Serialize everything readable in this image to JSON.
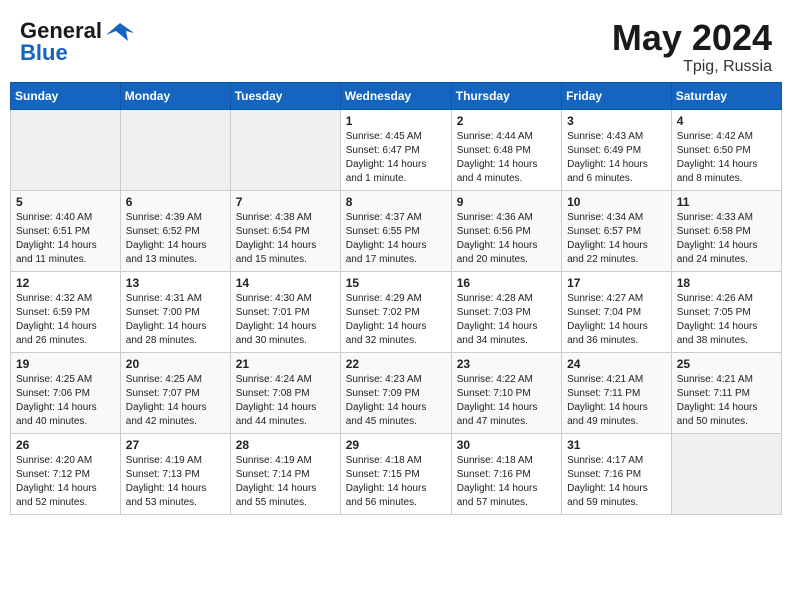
{
  "header": {
    "logo_general": "General",
    "logo_blue": "Blue",
    "month": "May 2024",
    "location": "Tpig, Russia"
  },
  "weekdays": [
    "Sunday",
    "Monday",
    "Tuesday",
    "Wednesday",
    "Thursday",
    "Friday",
    "Saturday"
  ],
  "weeks": [
    [
      {
        "day": "",
        "sunrise": "",
        "sunset": "",
        "daylight": ""
      },
      {
        "day": "",
        "sunrise": "",
        "sunset": "",
        "daylight": ""
      },
      {
        "day": "",
        "sunrise": "",
        "sunset": "",
        "daylight": ""
      },
      {
        "day": "1",
        "sunrise": "Sunrise: 4:45 AM",
        "sunset": "Sunset: 6:47 PM",
        "daylight": "Daylight: 14 hours and 1 minute."
      },
      {
        "day": "2",
        "sunrise": "Sunrise: 4:44 AM",
        "sunset": "Sunset: 6:48 PM",
        "daylight": "Daylight: 14 hours and 4 minutes."
      },
      {
        "day": "3",
        "sunrise": "Sunrise: 4:43 AM",
        "sunset": "Sunset: 6:49 PM",
        "daylight": "Daylight: 14 hours and 6 minutes."
      },
      {
        "day": "4",
        "sunrise": "Sunrise: 4:42 AM",
        "sunset": "Sunset: 6:50 PM",
        "daylight": "Daylight: 14 hours and 8 minutes."
      }
    ],
    [
      {
        "day": "5",
        "sunrise": "Sunrise: 4:40 AM",
        "sunset": "Sunset: 6:51 PM",
        "daylight": "Daylight: 14 hours and 11 minutes."
      },
      {
        "day": "6",
        "sunrise": "Sunrise: 4:39 AM",
        "sunset": "Sunset: 6:52 PM",
        "daylight": "Daylight: 14 hours and 13 minutes."
      },
      {
        "day": "7",
        "sunrise": "Sunrise: 4:38 AM",
        "sunset": "Sunset: 6:54 PM",
        "daylight": "Daylight: 14 hours and 15 minutes."
      },
      {
        "day": "8",
        "sunrise": "Sunrise: 4:37 AM",
        "sunset": "Sunset: 6:55 PM",
        "daylight": "Daylight: 14 hours and 17 minutes."
      },
      {
        "day": "9",
        "sunrise": "Sunrise: 4:36 AM",
        "sunset": "Sunset: 6:56 PM",
        "daylight": "Daylight: 14 hours and 20 minutes."
      },
      {
        "day": "10",
        "sunrise": "Sunrise: 4:34 AM",
        "sunset": "Sunset: 6:57 PM",
        "daylight": "Daylight: 14 hours and 22 minutes."
      },
      {
        "day": "11",
        "sunrise": "Sunrise: 4:33 AM",
        "sunset": "Sunset: 6:58 PM",
        "daylight": "Daylight: 14 hours and 24 minutes."
      }
    ],
    [
      {
        "day": "12",
        "sunrise": "Sunrise: 4:32 AM",
        "sunset": "Sunset: 6:59 PM",
        "daylight": "Daylight: 14 hours and 26 minutes."
      },
      {
        "day": "13",
        "sunrise": "Sunrise: 4:31 AM",
        "sunset": "Sunset: 7:00 PM",
        "daylight": "Daylight: 14 hours and 28 minutes."
      },
      {
        "day": "14",
        "sunrise": "Sunrise: 4:30 AM",
        "sunset": "Sunset: 7:01 PM",
        "daylight": "Daylight: 14 hours and 30 minutes."
      },
      {
        "day": "15",
        "sunrise": "Sunrise: 4:29 AM",
        "sunset": "Sunset: 7:02 PM",
        "daylight": "Daylight: 14 hours and 32 minutes."
      },
      {
        "day": "16",
        "sunrise": "Sunrise: 4:28 AM",
        "sunset": "Sunset: 7:03 PM",
        "daylight": "Daylight: 14 hours and 34 minutes."
      },
      {
        "day": "17",
        "sunrise": "Sunrise: 4:27 AM",
        "sunset": "Sunset: 7:04 PM",
        "daylight": "Daylight: 14 hours and 36 minutes."
      },
      {
        "day": "18",
        "sunrise": "Sunrise: 4:26 AM",
        "sunset": "Sunset: 7:05 PM",
        "daylight": "Daylight: 14 hours and 38 minutes."
      }
    ],
    [
      {
        "day": "19",
        "sunrise": "Sunrise: 4:25 AM",
        "sunset": "Sunset: 7:06 PM",
        "daylight": "Daylight: 14 hours and 40 minutes."
      },
      {
        "day": "20",
        "sunrise": "Sunrise: 4:25 AM",
        "sunset": "Sunset: 7:07 PM",
        "daylight": "Daylight: 14 hours and 42 minutes."
      },
      {
        "day": "21",
        "sunrise": "Sunrise: 4:24 AM",
        "sunset": "Sunset: 7:08 PM",
        "daylight": "Daylight: 14 hours and 44 minutes."
      },
      {
        "day": "22",
        "sunrise": "Sunrise: 4:23 AM",
        "sunset": "Sunset: 7:09 PM",
        "daylight": "Daylight: 14 hours and 45 minutes."
      },
      {
        "day": "23",
        "sunrise": "Sunrise: 4:22 AM",
        "sunset": "Sunset: 7:10 PM",
        "daylight": "Daylight: 14 hours and 47 minutes."
      },
      {
        "day": "24",
        "sunrise": "Sunrise: 4:21 AM",
        "sunset": "Sunset: 7:11 PM",
        "daylight": "Daylight: 14 hours and 49 minutes."
      },
      {
        "day": "25",
        "sunrise": "Sunrise: 4:21 AM",
        "sunset": "Sunset: 7:11 PM",
        "daylight": "Daylight: 14 hours and 50 minutes."
      }
    ],
    [
      {
        "day": "26",
        "sunrise": "Sunrise: 4:20 AM",
        "sunset": "Sunset: 7:12 PM",
        "daylight": "Daylight: 14 hours and 52 minutes."
      },
      {
        "day": "27",
        "sunrise": "Sunrise: 4:19 AM",
        "sunset": "Sunset: 7:13 PM",
        "daylight": "Daylight: 14 hours and 53 minutes."
      },
      {
        "day": "28",
        "sunrise": "Sunrise: 4:19 AM",
        "sunset": "Sunset: 7:14 PM",
        "daylight": "Daylight: 14 hours and 55 minutes."
      },
      {
        "day": "29",
        "sunrise": "Sunrise: 4:18 AM",
        "sunset": "Sunset: 7:15 PM",
        "daylight": "Daylight: 14 hours and 56 minutes."
      },
      {
        "day": "30",
        "sunrise": "Sunrise: 4:18 AM",
        "sunset": "Sunset: 7:16 PM",
        "daylight": "Daylight: 14 hours and 57 minutes."
      },
      {
        "day": "31",
        "sunrise": "Sunrise: 4:17 AM",
        "sunset": "Sunset: 7:16 PM",
        "daylight": "Daylight: 14 hours and 59 minutes."
      },
      {
        "day": "",
        "sunrise": "",
        "sunset": "",
        "daylight": ""
      }
    ]
  ]
}
